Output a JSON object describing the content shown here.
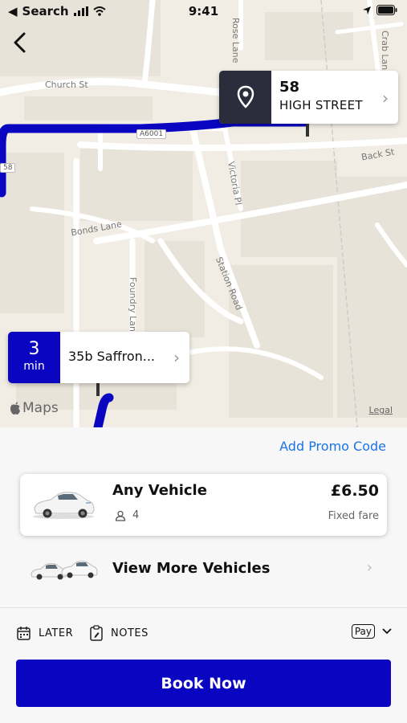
{
  "status_bar": {
    "carrier": "Search",
    "time": "9:41"
  },
  "map": {
    "roads": [
      "Church St",
      "A6001",
      "Rose Lane",
      "Crab Lane",
      "Back St",
      "Victoria Pl",
      "Bonds Lane",
      "Station Road",
      "Foundry Lane",
      "58"
    ],
    "destination": {
      "number": "58",
      "street": "HIGH STREET"
    },
    "pickup": {
      "eta_value": "3",
      "eta_unit": "min",
      "address": "35b Saffron..."
    },
    "maps_attribution": "Maps",
    "legal": "Legal"
  },
  "promo_label": "Add Promo Code",
  "vehicle": {
    "name": "Any Vehicle",
    "passengers": "4",
    "price": "£6.50",
    "fare_type": "Fixed fare"
  },
  "more_vehicles_label": "View More Vehicles",
  "options": {
    "later_label": "LATER",
    "notes_label": "NOTES",
    "payment_label": "Pay"
  },
  "book_button": "Book Now",
  "colors": {
    "primary": "#0a05c0",
    "dark_panel": "#2b2c3c",
    "link": "#1a73e8",
    "map_bg": "#f1ede4"
  }
}
